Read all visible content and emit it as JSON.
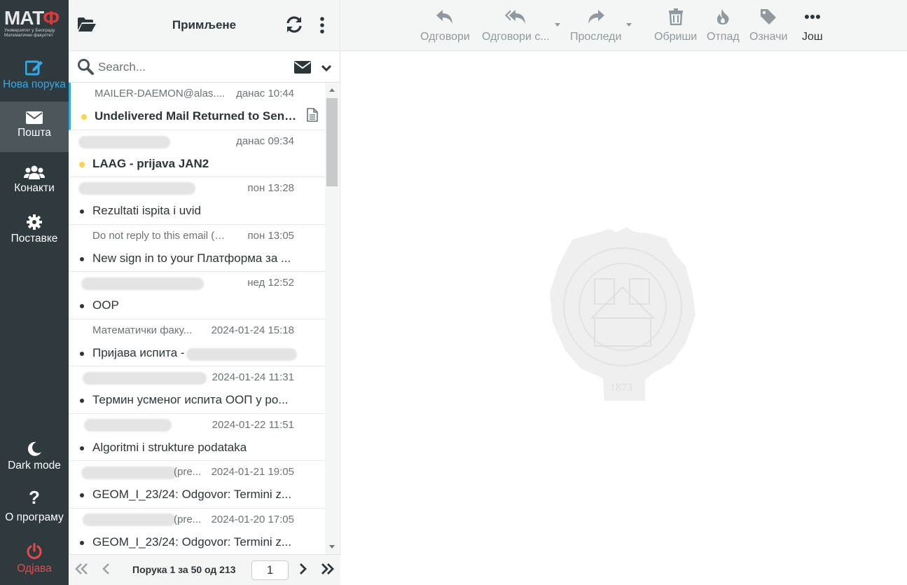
{
  "brand": {
    "name_part1": "МАТ",
    "name_part2": "Ф",
    "subtitle_line1": "Универзитет у Београду",
    "subtitle_line2": "Математички факултет"
  },
  "nav": {
    "compose": "Нова порука",
    "mail": "Пошта",
    "contacts": "Конакти",
    "settings": "Поставке",
    "dark_mode": "Dark mode",
    "about": "О програму",
    "logout": "Одјава"
  },
  "list_header": {
    "title": "Примљене"
  },
  "search": {
    "placeholder": "Search..."
  },
  "messages": [
    {
      "from": "MAILER-DAEMON@alas....",
      "date": "данас 10:44",
      "subject": "Undelivered Mail Returned to Sender"
    },
    {
      "from": "",
      "date": "данас 09:34",
      "subject": "LAAG - prijava JAN2"
    },
    {
      "from": "",
      "date": "пон 13:28",
      "subject": "Rezultati ispita i uvid"
    },
    {
      "from": "Do not reply to this email (vi...",
      "date": "пон 13:05",
      "subject": "New sign in to your Платформа за ..."
    },
    {
      "from": "",
      "date": "нед 12:52",
      "subject": "OOP"
    },
    {
      "from": "Математички факу...",
      "date": "2024-01-24 15:18",
      "subject": "Пријава испита -"
    },
    {
      "from": "",
      "date": "2024-01-24 11:31",
      "subject": "Термин усменог испита ООП у ро..."
    },
    {
      "from": "",
      "date": "2024-01-22 11:51",
      "subject": "Algoritmi i strukture podataka"
    },
    {
      "from": "(pre...",
      "date": "2024-01-21 19:05",
      "subject": "GEOM_I_23/24: Odgovor: Termini z..."
    },
    {
      "from": "(pre...",
      "date": "2024-01-20 17:05",
      "subject": "GEOM_I_23/24: Odgovor: Termini z..."
    }
  ],
  "pager": {
    "info": "Порука 1 за 50 од 213",
    "page": "1"
  },
  "toolbar": {
    "reply": "Одговори",
    "reply_all": "Одговори с...",
    "forward": "Проследи",
    "delete": "Обриши",
    "junk": "Отпад",
    "mark": "Означи",
    "more": "Још"
  },
  "watermark": {
    "year": "1873"
  },
  "colors": {
    "nav_bg": "#2f3a3f",
    "accent": "#37a8e6",
    "unread_dot": "#ffd34e",
    "logout": "#e44a4a"
  }
}
